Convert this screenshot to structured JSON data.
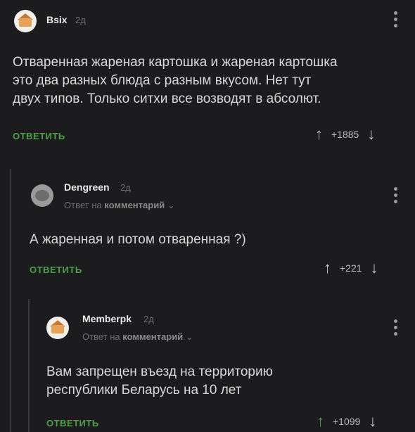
{
  "comments": [
    {
      "username": "Bsix",
      "time": "2д",
      "text_lines": [
        "Отваренная жареная картошка и жареная картошка",
        "это два разных блюда с разным вкусом. Нет тут",
        "двух типов. Только ситхи все возводят в абсолют."
      ],
      "reply_label": "ОТВЕТИТЬ",
      "score": "+1885"
    },
    {
      "username": "Dengreen",
      "time": "2д",
      "reply_to_prefix": "Ответ на",
      "reply_to_target": "комментарий",
      "text_lines": [
        "А жаренная и потом отваренная ?)"
      ],
      "reply_label": "ОТВЕТИТЬ",
      "score": "+221"
    },
    {
      "username": "Memberpk",
      "time": "2д",
      "reply_to_prefix": "Ответ на",
      "reply_to_target": "комментарий",
      "text_lines": [
        "Вам запрещен въезд на территорию",
        "республики Беларусь на 10 лет"
      ],
      "reply_label": "ОТВЕТИТЬ",
      "score": "+1099"
    }
  ],
  "icons": {
    "upvote": "arrow-up-icon",
    "downvote": "arrow-down-icon",
    "menu": "more-vertical-icon",
    "chevron": "chevron-down-icon"
  },
  "colors": {
    "background": "#1c1c1e",
    "reply_green": "#4f9e4f"
  }
}
